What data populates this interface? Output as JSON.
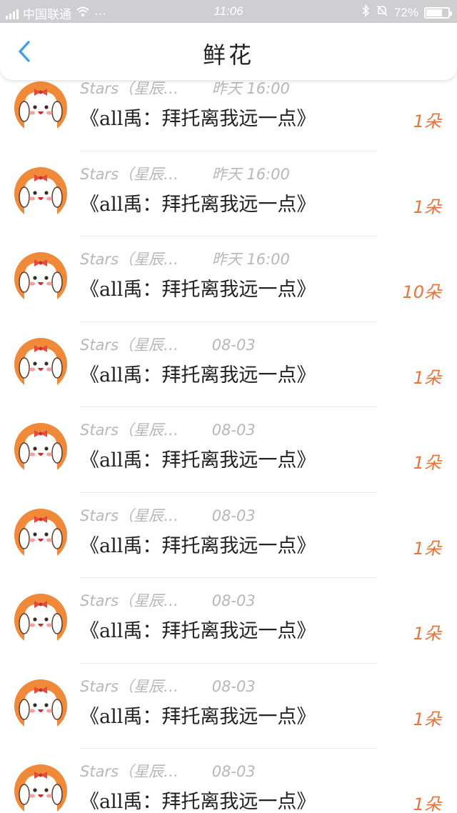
{
  "status_bar": {
    "carrier": "中国联通",
    "time": "11:06",
    "battery": "72%",
    "battery_level": 0.72
  },
  "header": {
    "title": "鲜花"
  },
  "colors": {
    "accent": "#3aa0e8",
    "count": "#e8743a",
    "avatar_bg": "#f08a3a"
  },
  "gifts": [
    {
      "sender": "Stars（星辰…",
      "time": "昨天 16:00",
      "title": "《all禹：拜托离我远一点》",
      "count": "1朵"
    },
    {
      "sender": "Stars（星辰…",
      "time": "昨天 16:00",
      "title": "《all禹：拜托离我远一点》",
      "count": "1朵"
    },
    {
      "sender": "Stars（星辰…",
      "time": "昨天 16:00",
      "title": "《all禹：拜托离我远一点》",
      "count": "10朵"
    },
    {
      "sender": "Stars（星辰…",
      "time": "08-03",
      "title": "《all禹：拜托离我远一点》",
      "count": "1朵"
    },
    {
      "sender": "Stars（星辰…",
      "time": "08-03",
      "title": "《all禹：拜托离我远一点》",
      "count": "1朵"
    },
    {
      "sender": "Stars（星辰…",
      "time": "08-03",
      "title": "《all禹：拜托离我远一点》",
      "count": "1朵"
    },
    {
      "sender": "Stars（星辰…",
      "time": "08-03",
      "title": "《all禹：拜托离我远一点》",
      "count": "1朵"
    },
    {
      "sender": "Stars（星辰…",
      "time": "08-03",
      "title": "《all禹：拜托离我远一点》",
      "count": "1朵"
    },
    {
      "sender": "Stars（星辰…",
      "time": "08-03",
      "title": "《all禹：拜托离我远一点》",
      "count": "1朵"
    }
  ]
}
